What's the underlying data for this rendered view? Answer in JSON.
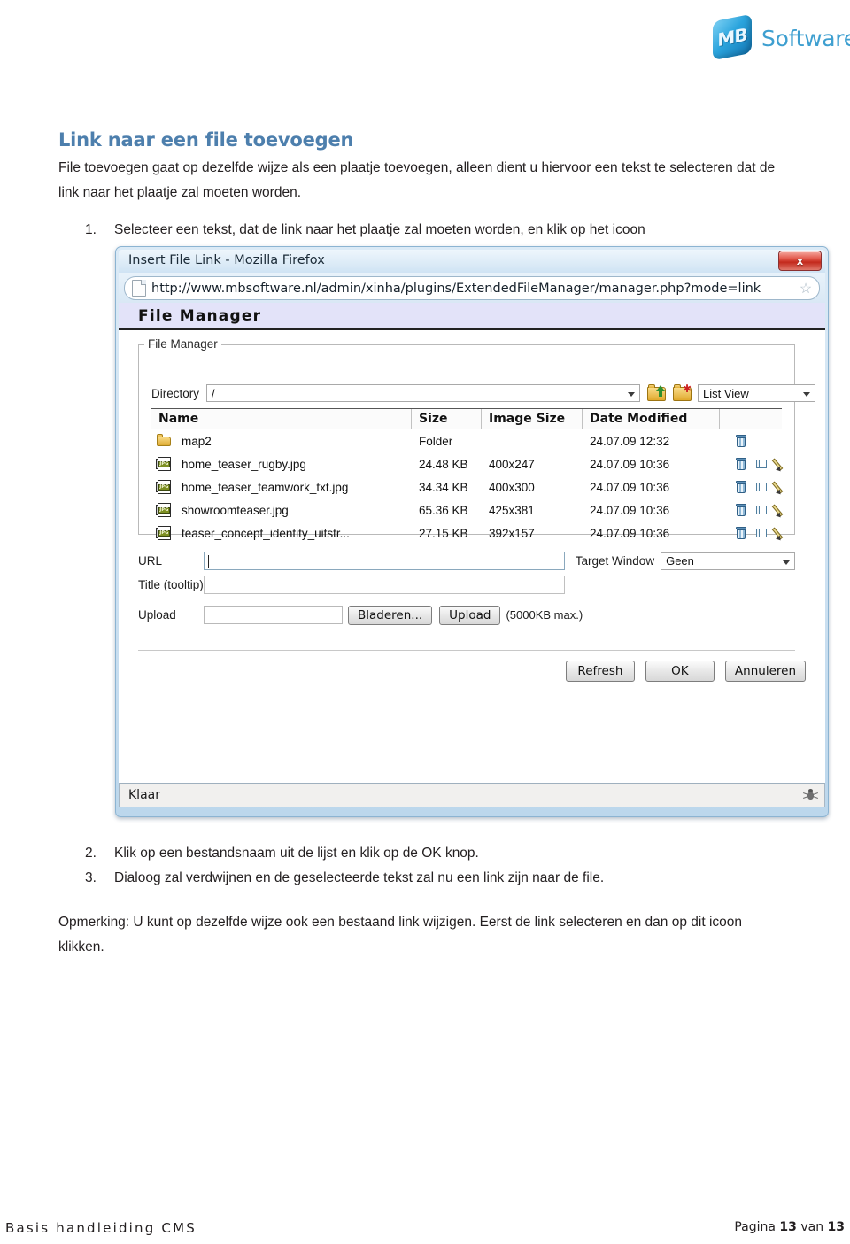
{
  "brand": {
    "cube_text": "MB",
    "word": "Software"
  },
  "doc": {
    "heading": "Link naar een file toevoegen",
    "intro": "File toevoegen gaat op dezelfde wijze als een plaatje toevoegen, alleen dient u hiervoor een tekst te selecteren dat de link naar het plaatje zal moeten worden.",
    "step1_num": "1.",
    "step1": "Selecteer een tekst, dat de link naar het plaatje zal moeten worden, en klik op het icoon",
    "step2_num": "2.",
    "step2": "Klik op een bestandsnaam uit de lijst en klik op de OK knop.",
    "step3_num": "3.",
    "step3": "Dialoog zal verdwijnen en de geselecteerde tekst zal nu een link zijn naar de file.",
    "note": "Opmerking:  U kunt op dezelfde wijze ook een bestaand link wijzigen. Eerst de link  selecteren en dan op dit icoon klikken."
  },
  "dialog": {
    "window_title": "Insert File Link - Mozilla Firefox",
    "close_label": "x",
    "url": "http://www.mbsoftware.nl/admin/xinha/plugins/ExtendedFileManager/manager.php?mode=link",
    "page_heading": "File Manager",
    "fieldset_legend": "File Manager",
    "directory_label": "Directory",
    "directory_value": "/",
    "view_value": "List View",
    "toolbar": {
      "up_folder": "go-up-folder",
      "new_folder": "new-folder"
    },
    "table": {
      "headers": [
        "Name",
        "Size",
        "Image Size",
        "Date Modified",
        ""
      ],
      "rows": [
        {
          "icon": "folder-icon",
          "name": "map2",
          "size": "Folder",
          "image_size": "",
          "date": "24.07.09 12:32",
          "actions": [
            "delete-icon"
          ]
        },
        {
          "icon": "jpg-file-icon",
          "name": "home_teaser_rugby.jpg",
          "size": "24.48 KB",
          "image_size": "400x247",
          "date": "24.07.09 10:36",
          "actions": [
            "delete-icon",
            "resize-icon",
            "edit-icon"
          ]
        },
        {
          "icon": "jpg-file-icon",
          "name": "home_teaser_teamwork_txt.jpg",
          "size": "34.34 KB",
          "image_size": "400x300",
          "date": "24.07.09 10:36",
          "actions": [
            "delete-icon",
            "resize-icon",
            "edit-icon"
          ]
        },
        {
          "icon": "jpg-file-icon",
          "name": "showroomteaser.jpg",
          "size": "65.36 KB",
          "image_size": "425x381",
          "date": "24.07.09 10:36",
          "actions": [
            "delete-icon",
            "resize-icon",
            "edit-icon"
          ]
        },
        {
          "icon": "jpg-file-icon",
          "name": "teaser_concept_identity_uitstr...",
          "size": "27.15 KB",
          "image_size": "392x157",
          "date": "24.07.09 10:36",
          "actions": [
            "delete-icon",
            "resize-icon",
            "edit-icon"
          ]
        }
      ]
    },
    "form": {
      "url_label": "URL",
      "url_value": "",
      "target_window_label": "Target Window",
      "target_window_value": "Geen",
      "title_label": "Title (tooltip)",
      "title_value": "",
      "upload_label": "Upload",
      "upload_value": "",
      "browse_button": "Bladeren...",
      "upload_button": "Upload",
      "upload_note": "(5000KB max.)"
    },
    "buttons": {
      "refresh": "Refresh",
      "ok": "OK",
      "cancel": "Annuleren"
    },
    "status": {
      "text": "Klaar",
      "icon": "bug-icon"
    }
  },
  "footer": {
    "left": "Basis handleiding CMS",
    "right_prefix": "Pagina ",
    "page": "13",
    "right_middle": " van ",
    "total": "13"
  },
  "colors": {
    "heading": "#4d7fad",
    "brand": "#3e9fd0",
    "fm_band": "#e3e3f9",
    "close_button": "#c3291c",
    "folder": "#ddab33",
    "jpg_badge": "#7d8f22",
    "trash": "#5d90b8",
    "pencil": "#d6c069"
  }
}
